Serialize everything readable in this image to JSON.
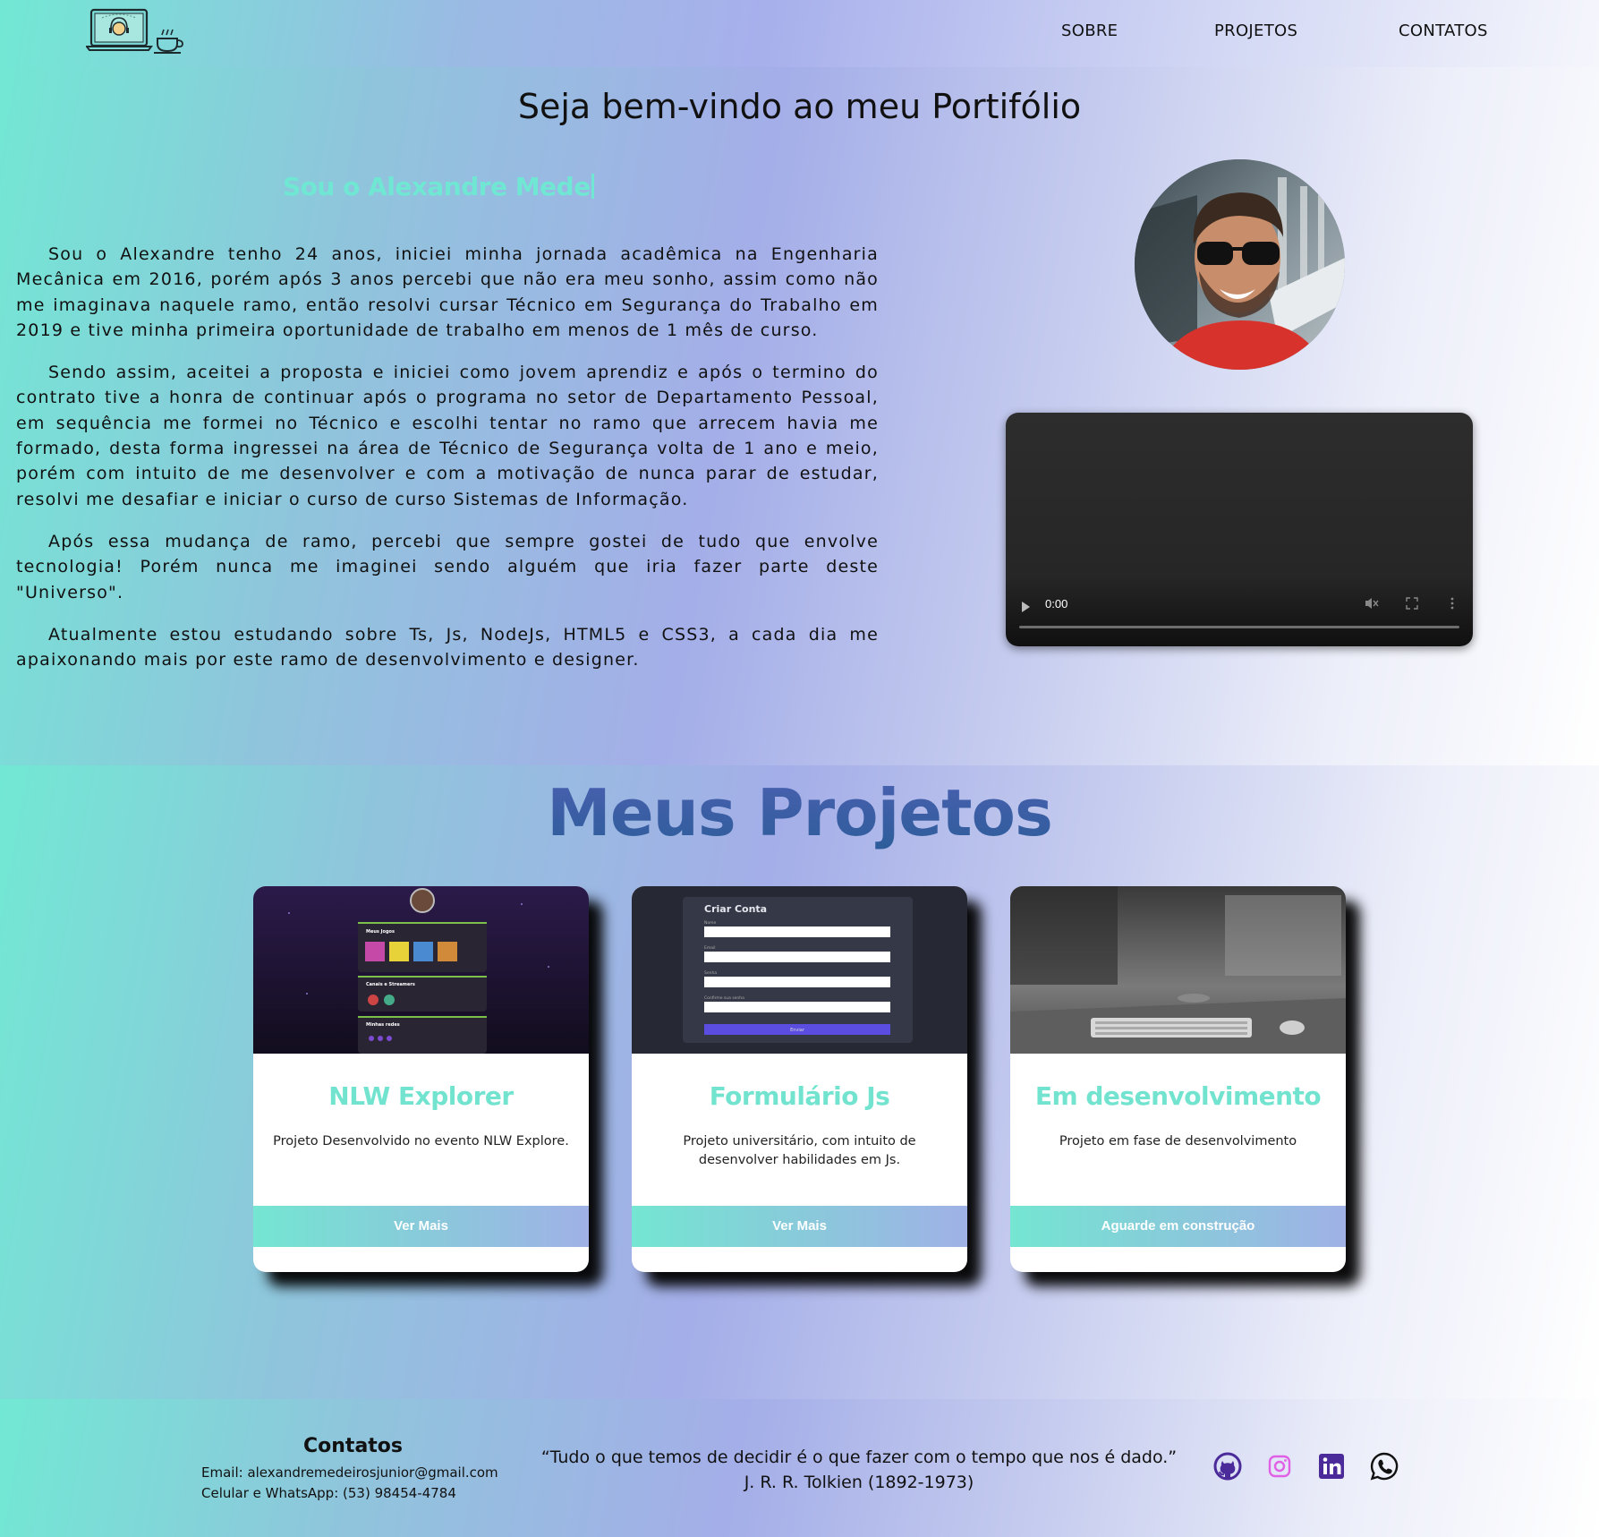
{
  "nav": {
    "items": [
      {
        "label": "SOBRE"
      },
      {
        "label": "PROJETOS"
      },
      {
        "label": "CONTATOS"
      }
    ]
  },
  "hero": {
    "title": "Seja bem-vindo ao meu Portifólio",
    "typing_text": "Sou o Alexandre Mede",
    "bio": [
      "Sou o Alexandre tenho 24 anos, iniciei minha jornada acadêmica na Engenharia Mecânica em 2016, porém após 3 anos percebi que não era meu sonho, assim como não me imaginava naquele ramo, então resolvi cursar Técnico em Segurança do Trabalho em 2019 e tive minha primeira oportunidade de trabalho em menos de 1 mês de curso.",
      "Sendo assim, aceitei a proposta e iniciei como jovem aprendiz e após o termino do contrato tive a honra de continuar após o programa no setor de Departamento Pessoal, em sequência me formei no Técnico e escolhi tentar no ramo que arrecem havia me formado, desta forma ingressei na área de Técnico de Segurança volta de 1 ano e meio, porém com intuito de me desenvolver e com a motivação de nunca parar de estudar, resolvi me desafiar e iniciar o curso de curso Sistemas de Informação.",
      "Após essa mudança de ramo, percebi que sempre gostei de tudo que envolve tecnologia! Porém nunca me imaginei sendo alguém que iria fazer parte deste \"Universo\".",
      "Atualmente estou estudando sobre Ts, Js, NodeJs, HTML5 e CSS3, a cada dia me apaixonando mais por este ramo de desenvolvimento e designer."
    ],
    "video": {
      "time": "0:00"
    }
  },
  "projects": {
    "title": "Meus Projetos",
    "cards": [
      {
        "title": "NLW Explorer",
        "description": "Projeto Desenvolvido no evento NLW Explore.",
        "button": "Ver Mais"
      },
      {
        "title": "Formulário Js",
        "description": "Projeto universitário, com intuito de desenvolver habilidades em Js.",
        "button": "Ver Mais"
      },
      {
        "title": "Em desenvolvimento",
        "description": "Projeto em fase de desenvolvimento",
        "button": "Aguarde em construção"
      }
    ],
    "form_thumb": {
      "heading": "Criar Conta",
      "fields": [
        "Nome",
        "Email",
        "Senha",
        "Confirme sua senha"
      ],
      "submit": "Enviar"
    },
    "nlw_thumb": {
      "sections": [
        "Meus Jogos",
        "Canais e Streamers",
        "Minhas redes"
      ]
    }
  },
  "footer": {
    "title": "Contatos",
    "email": "Email: alexandremedeirosjunior@gmail.com",
    "phone": "Celular e WhatsApp: (53) 98454-4784",
    "quote": "“Tudo o que temos de decidir é o que fazer com o tempo que nos é dado.”",
    "quote_author": "J. R. R. Tolkien (1892-1973)"
  },
  "icons": {
    "logo": "laptop-coffee-logo-icon",
    "social": [
      "github-icon",
      "instagram-icon",
      "linkedin-icon",
      "whatsapp-icon"
    ]
  },
  "colors": {
    "accent_teal": "#72e3cf",
    "title_blue": "#3d5aa6",
    "github": "#4b2a9a",
    "instagram": "#e060e6",
    "linkedin": "#4b2a9a",
    "whatsapp": "#111111"
  }
}
